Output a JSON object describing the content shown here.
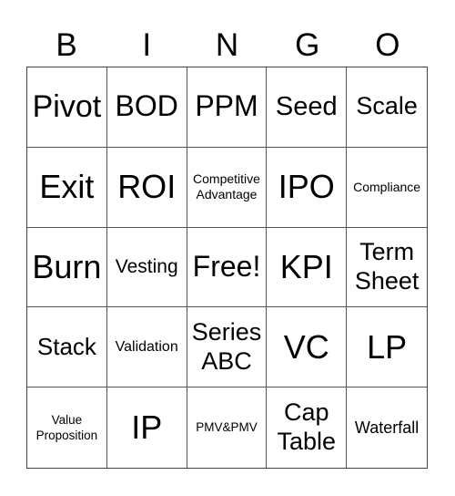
{
  "header": {
    "letters": [
      "B",
      "I",
      "N",
      "G",
      "O"
    ]
  },
  "card": {
    "rows": [
      [
        "Pivot",
        "BOD",
        "PPM",
        "Seed",
        "Scale"
      ],
      [
        "Exit",
        "ROI",
        "Competitive\nAdvantage",
        "IPO",
        "Compliance"
      ],
      [
        "Burn",
        "Vesting",
        "Free!",
        "KPI",
        "Term\nSheet"
      ],
      [
        "Stack",
        "Validation",
        "Series\nABC",
        "VC",
        "LP"
      ],
      [
        "Value\nProposition",
        "IP",
        "PMV&PMV",
        "Cap\nTable",
        "Waterfall"
      ]
    ],
    "free_space": "Free!"
  }
}
